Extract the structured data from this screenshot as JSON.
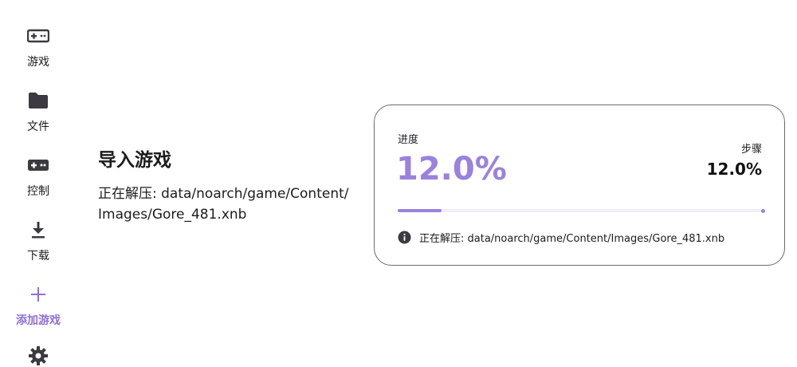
{
  "nav": {
    "items": [
      {
        "label": "游戏",
        "icon": "gamepad-icon"
      },
      {
        "label": "文件",
        "icon": "folder-icon"
      },
      {
        "label": "控制",
        "icon": "controller-icon"
      },
      {
        "label": "下载",
        "icon": "download-icon"
      },
      {
        "label": "添加游戏",
        "icon": "add-icon",
        "active": true
      },
      {
        "label": "",
        "icon": "settings-icon"
      }
    ],
    "accent_color": "#8f6fd6"
  },
  "main": {
    "title": "导入游戏",
    "status_line1": "正在解压: data/noarch/game/Content/",
    "status_line2": "Images/Gore_481.xnb"
  },
  "card": {
    "progress_label": "进度",
    "progress_value": "12.0%",
    "progress_fraction": 0.12,
    "step_label": "步骤",
    "step_value": "12.0%",
    "info_text": "正在解压: data/noarch/game/Content/Images/Gore_481.xnb",
    "accent_color": "#9a82de"
  }
}
